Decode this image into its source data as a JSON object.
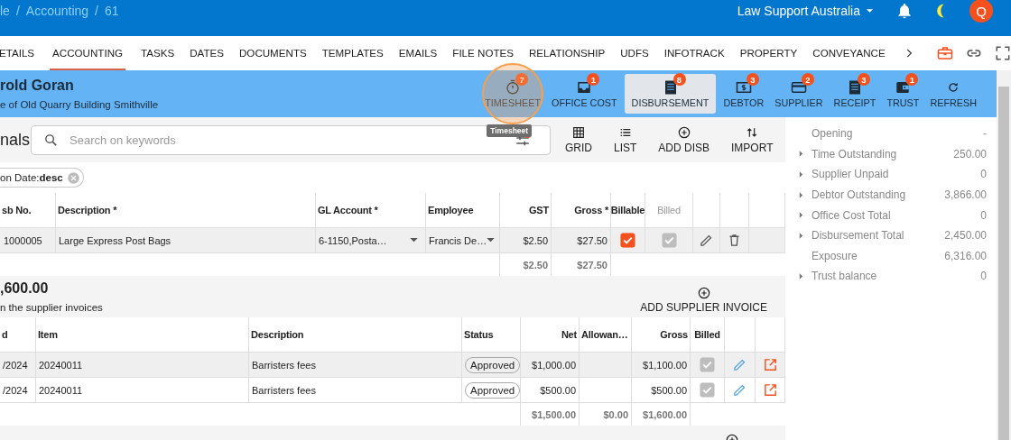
{
  "breadcrumb": [
    "le",
    "Accounting",
    "61"
  ],
  "breadcrumb_separator": "/",
  "account": {
    "name": "Law Support Australia"
  },
  "user": {
    "initial": "Q"
  },
  "tabs": [
    {
      "label": "ETAILS",
      "selected": false
    },
    {
      "label": "ACCOUNTING",
      "selected": true
    },
    {
      "label": "TASKS",
      "selected": false
    },
    {
      "label": "DATES",
      "selected": false
    },
    {
      "label": "DOCUMENTS",
      "selected": false
    },
    {
      "label": "TEMPLATES",
      "selected": false
    },
    {
      "label": "EMAILS",
      "selected": false
    },
    {
      "label": "FILE NOTES",
      "selected": false
    },
    {
      "label": "RELATIONSHIP",
      "selected": false
    },
    {
      "label": "UDFS",
      "selected": false
    },
    {
      "label": "INFOTRACK",
      "selected": false
    },
    {
      "label": "PROPERTY",
      "selected": false
    },
    {
      "label": "CONVEYANCE",
      "selected": false
    }
  ],
  "matter": {
    "name": "rold Goran",
    "subtitle": "e of Old Quarry Building Smithville"
  },
  "toolbar": [
    {
      "kind": "timer",
      "label": "TIMESHEET",
      "badge": "7",
      "selected": false,
      "highlighted": true,
      "tooltip": "Timesheet"
    },
    {
      "kind": "tray",
      "label": "OFFICE COST",
      "badge": "1",
      "selected": false,
      "highlighted": false
    },
    {
      "kind": "document",
      "label": "DISBURSEMENT",
      "badge": "8",
      "selected": true,
      "highlighted": false
    },
    {
      "kind": "dollar",
      "label": "DEBTOR",
      "badge": "3",
      "selected": false,
      "highlighted": false
    },
    {
      "kind": "card",
      "label": "SUPPLIER",
      "badge": "2",
      "selected": false,
      "highlighted": false
    },
    {
      "kind": "document",
      "label": "RECEIPT",
      "badge": "3",
      "selected": false,
      "highlighted": false
    },
    {
      "kind": "wallet",
      "label": "TRUST",
      "badge": "1",
      "selected": false,
      "highlighted": false
    },
    {
      "kind": "refresh",
      "label": "REFRESH",
      "selected": false,
      "highlighted": false
    }
  ],
  "section": {
    "title": "nals",
    "search": {
      "placeholder": "Search on keywords"
    },
    "actions": [
      {
        "kind": "grid",
        "label": "GRID"
      },
      {
        "kind": "list",
        "label": "LIST"
      },
      {
        "kind": "add",
        "label": "ADD DISB"
      },
      {
        "kind": "import",
        "label": "IMPORT"
      }
    ]
  },
  "sort_chip": {
    "label": "on Date:**desc**"
  },
  "disbursements": {
    "columns": [
      {
        "label": "sb No.",
        "disabled": false
      },
      {
        "label": "Description *",
        "disabled": false
      },
      {
        "label": "GL Account *",
        "disabled": false
      },
      {
        "label": "Employee",
        "disabled": false
      },
      {
        "label": "GST",
        "disabled": false
      },
      {
        "label": "Gross *",
        "disabled": false
      },
      {
        "label": "Billable",
        "disabled": false
      },
      {
        "label": "Billed",
        "disabled": true
      }
    ],
    "rows": [
      {
        "disb_no": " 1000005",
        "description": "Large Express Post Bags",
        "gl_account": "6-1150,Posta…",
        "employee": "Francis De…",
        "gst": "$2.50",
        "gross": "$27.50",
        "billable": true,
        "billed": true,
        "selected": true
      }
    ],
    "totals": {
      "gst": "$2.50",
      "gross": "$27.50"
    }
  },
  "supplier_invoices": {
    "total": ",600.00",
    "note": "n the supplier invoices",
    "add_label": "ADD SUPPLIER INVOICE",
    "columns": [
      {
        "label": "d"
      },
      {
        "label": "Item"
      },
      {
        "label": "Description"
      },
      {
        "label": "Status"
      },
      {
        "label": "Net"
      },
      {
        "label": "Allowan…"
      },
      {
        "label": "Gross"
      },
      {
        "label": "Billed"
      }
    ],
    "rows": [
      {
        "date": "/2024",
        "item": "20240011",
        "description": "Barristers fees",
        "status": "Approved",
        "net": "$1,000.00",
        "gross": "$1,100.00",
        "billed": true,
        "selected": true
      },
      {
        "date": "/2024",
        "item": "20240011",
        "description": "Barristers fees",
        "status": "Approved",
        "net": "$500.00",
        "gross": "$500.00",
        "billed": true,
        "selected": false
      }
    ],
    "totals": {
      "net": "$1,500.00",
      "allowance": "$0.00",
      "gross": "$1,600.00"
    }
  },
  "summary": [
    {
      "label": "Opening",
      "value": "-",
      "expandable": false
    },
    {
      "label": "Time Outstanding",
      "value": "250.00",
      "expandable": true
    },
    {
      "label": "Supplier Unpaid",
      "value": "0",
      "expandable": true
    },
    {
      "label": "Debtor Outstanding",
      "value": "3,866.00",
      "expandable": true
    },
    {
      "label": "Office Cost Total",
      "value": "0",
      "expandable": true
    },
    {
      "label": "Disbursement Total",
      "value": "2,450.00",
      "expandable": true
    },
    {
      "label": "Exposure",
      "value": "6,316.00",
      "expandable": false
    },
    {
      "label": "Trust balance",
      "value": "0",
      "expandable": true
    }
  ]
}
